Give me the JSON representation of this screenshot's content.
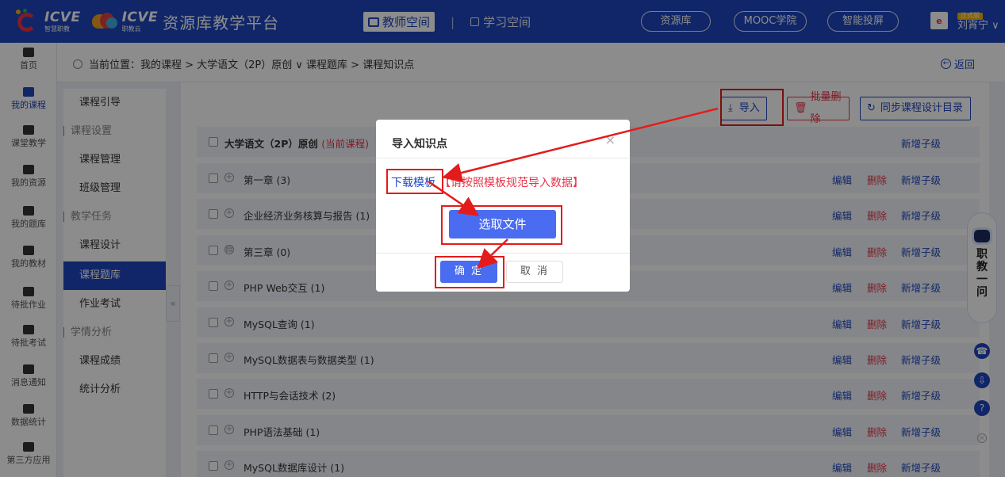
{
  "topbar": {
    "logo1_text": "ICVE",
    "logo1_sub": "智慧职教",
    "logo2_text": "ICVE",
    "logo2_sub": "职教云",
    "platform_name": "资源库教学平台",
    "teacher_space": "教师空间",
    "study_space": "学习空间",
    "pill_resource": "资源库",
    "pill_mooc": "MOOC学院",
    "pill_cast": "智能投屏",
    "user_badge": "正式版",
    "user_name": "刘宵宁 ∨"
  },
  "leftnav": {
    "items": [
      {
        "label": "首页"
      },
      {
        "label": "我的课程"
      },
      {
        "label": "课堂教学"
      },
      {
        "label": "我的资源"
      },
      {
        "label": "我的题库"
      },
      {
        "label": "我的教材"
      },
      {
        "label": "待批作业"
      },
      {
        "label": "待批考试"
      },
      {
        "label": "消息通知"
      },
      {
        "label": "数据统计"
      },
      {
        "label": "第三方应用"
      }
    ]
  },
  "breadcrumb": {
    "text": "当前位置：我的课程 > 大学语文（2P）原创 ∨  课程题库 > 课程知识点",
    "back": "返回"
  },
  "subnav": {
    "items": [
      {
        "label": "课程引导",
        "type": "item"
      },
      {
        "label": "课程设置",
        "type": "group"
      },
      {
        "label": "课程管理",
        "type": "item"
      },
      {
        "label": "班级管理",
        "type": "item"
      },
      {
        "label": "教学任务",
        "type": "group"
      },
      {
        "label": "课程设计",
        "type": "item"
      },
      {
        "label": "课程题库",
        "type": "active"
      },
      {
        "label": "作业考试",
        "type": "item"
      },
      {
        "label": "学情分析",
        "type": "group"
      },
      {
        "label": "课程成绩",
        "type": "item"
      },
      {
        "label": "统计分析",
        "type": "item"
      }
    ]
  },
  "toolbar": {
    "import_label": "导入",
    "batch_delete_label": "批量删除",
    "sync_label": "同步课程设计目录"
  },
  "tree": {
    "header": {
      "name": "大学语文（2P）原创",
      "tag": "(当前课程)",
      "add_child": "新增子级"
    },
    "rows": [
      {
        "name": "第一章 (3)",
        "edit": "编辑",
        "delete": "删除",
        "add_child": "新增子级"
      },
      {
        "name": "企业经济业务核算与报告 (1)",
        "edit": "编辑",
        "delete": "删除",
        "add_child": "新增子级"
      },
      {
        "name": "第三章 (0)",
        "edit": "编辑",
        "delete": "删除",
        "add_child": "新增子级"
      },
      {
        "name": "PHP Web交互 (1)",
        "edit": "编辑",
        "delete": "删除",
        "add_child": "新增子级"
      },
      {
        "name": "MySQL查询 (1)",
        "edit": "编辑",
        "delete": "删除",
        "add_child": "新增子级"
      },
      {
        "name": "MySQL数据表与数据类型 (1)",
        "edit": "编辑",
        "delete": "删除",
        "add_child": "新增子级"
      },
      {
        "name": "HTTP与会话技术 (2)",
        "edit": "编辑",
        "delete": "删除",
        "add_child": "新增子级"
      },
      {
        "name": "PHP语法基础 (1)",
        "edit": "编辑",
        "delete": "删除",
        "add_child": "新增子级"
      },
      {
        "name": "MySQL数据库设计 (1)",
        "edit": "编辑",
        "delete": "删除",
        "add_child": "新增子级"
      }
    ]
  },
  "modal": {
    "title": "导入知识点",
    "close": "×",
    "download_template": "下载模板",
    "tip": "【请按照模板规范导入数据】",
    "choose_file": "选取文件",
    "ok": "确 定",
    "cancel": "取 消"
  },
  "assistant": {
    "label": "职教一问"
  },
  "colors": {
    "primary": "#1e46bd",
    "button_blue": "#4a6cf0",
    "danger": "#e8344a",
    "annotation_red": "#e41b1b"
  }
}
